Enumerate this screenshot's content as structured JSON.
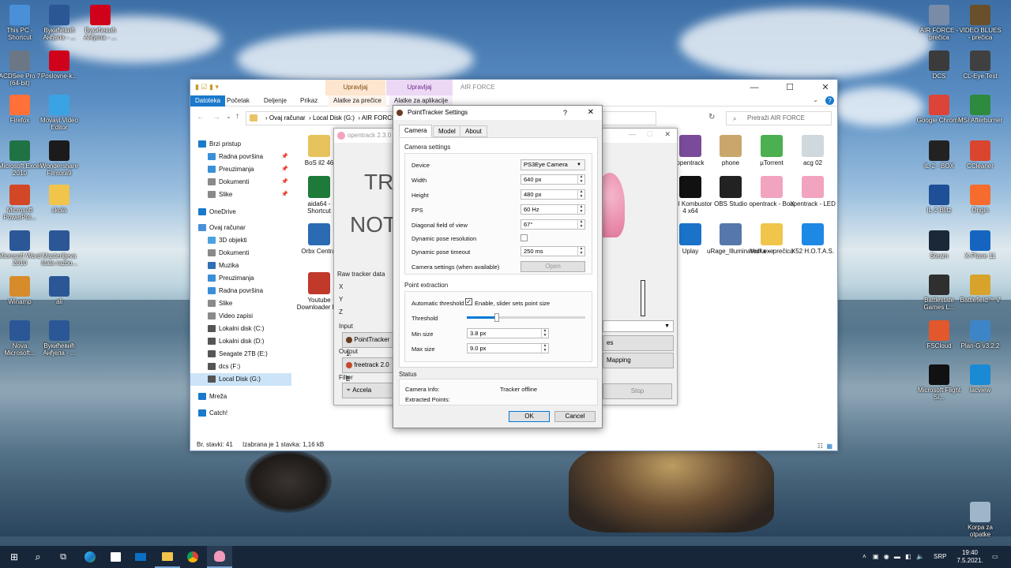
{
  "desktop_left": [
    {
      "label": "This PC - Shortcut",
      "icon": "this-pc-icon"
    },
    {
      "label": "Вукићевић Анђела - ...",
      "icon": "word-doc-icon"
    },
    {
      "label": "Вукићевић Анђела - ...",
      "icon": "pdf-icon"
    },
    {
      "label": "ACDSee Pro 7 (64-bit)",
      "icon": "acdsee-icon"
    },
    {
      "label": "Poslovne-k...",
      "icon": "pdf-icon"
    },
    {
      "label": "Firefox",
      "icon": "firefox-icon"
    },
    {
      "label": "Movavi Video Editor",
      "icon": "movavi-icon"
    },
    {
      "label": "Microsoft Excel 2010",
      "icon": "excel-icon"
    },
    {
      "label": "Wondershare Filmora9",
      "icon": "filmora-icon"
    },
    {
      "label": "Microsoft PowerPoi...",
      "icon": "powerpoint-icon"
    },
    {
      "label": "skola",
      "icon": "folder-icon"
    },
    {
      "label": "Microsoft Word 2010",
      "icon": "word-icon"
    },
    {
      "label": "Masterlijeva štala razbo...",
      "icon": "word-doc-icon"
    },
    {
      "label": "Winamp",
      "icon": "winamp-icon"
    },
    {
      "label": "ali",
      "icon": "word-doc-icon"
    },
    {
      "label": "Nova Microsoft...",
      "icon": "word-doc-icon"
    },
    {
      "label": "Вукићевић Анђела - ...",
      "icon": "word-doc-icon"
    }
  ],
  "desktop_right": [
    {
      "label": "AIR FORCE - prečica",
      "icon": "shortcut-doc-icon"
    },
    {
      "label": "VIDEO BLUES - prečica",
      "icon": "video-folder-icon"
    },
    {
      "label": "DCS",
      "icon": "dcs-icon"
    },
    {
      "label": "CL-Eye Test",
      "icon": "camera-icon"
    },
    {
      "label": "Google Chrome",
      "icon": "chrome-icon"
    },
    {
      "label": "MSI Afterburner",
      "icon": "msi-icon"
    },
    {
      "label": "IL-2 - BOX",
      "icon": "il2-icon"
    },
    {
      "label": "CCleaner",
      "icon": "ccleaner-icon"
    },
    {
      "label": "IL-2 Blitz",
      "icon": "il2-blitz-icon"
    },
    {
      "label": "Origin",
      "icon": "origin-icon"
    },
    {
      "label": "Steam",
      "icon": "steam-icon"
    },
    {
      "label": "X-Plane 11",
      "icon": "xplane-icon"
    },
    {
      "label": "Battlestate Games L...",
      "icon": "battlestate-icon"
    },
    {
      "label": "Battlefield™ V",
      "icon": "battlefield-icon"
    },
    {
      "label": "FSCloud",
      "icon": "fscloud-icon"
    },
    {
      "label": "Plan-G v3.2.2",
      "icon": "planeg-icon"
    },
    {
      "label": "Microsoft Flight Si...",
      "icon": "flightsim-icon"
    },
    {
      "label": "lacview",
      "icon": "lacview-icon"
    },
    {
      "label": "Korpa za otpatke",
      "icon": "recycle-bin-icon"
    }
  ],
  "explorer": {
    "quick_tabs": [
      "Upravljaj",
      "Upravljaj"
    ],
    "path_title": "AIR FORCE",
    "ribbon_tabs": [
      "Datoteka",
      "Početak",
      "Deljenje",
      "Prikaz",
      "Alatke za prečice",
      "Alatke za aplikacije"
    ],
    "address": [
      "Ovaj računar",
      "Local Disk (G:)",
      "AIR FORCE"
    ],
    "search_placeholder": "Pretraži AIR FORCE",
    "nav": [
      "Brzi pristup",
      "Radna površina",
      "Preuzimanja",
      "Dokumenti",
      "Slike",
      "OneDrive",
      "Ovaj računar",
      "3D objekti",
      "Dokumenti",
      "Muzika",
      "Preuzimanja",
      "Radna površina",
      "Slike",
      "Video zapisi",
      "Lokalni disk (C:)",
      "Lokalni disk (D:)",
      "Seagate 2TB (E:)",
      "dcs (F:)",
      "Local Disk (G:)",
      "Mreža",
      "Catch!"
    ],
    "files_left": [
      {
        "label": "BoS il2 46"
      },
      {
        "label": "aida64 - Shortcut"
      },
      {
        "label": "Orbx Central"
      },
      {
        "label": "Youtube Downloader HD"
      }
    ],
    "files_right": [
      {
        "label": "opentrack"
      },
      {
        "label": "phone"
      },
      {
        "label": "µTorrent"
      },
      {
        "label": "acg 02"
      },
      {
        "label": "MSI Kombustor 4 x64"
      },
      {
        "label": "OBS Studio"
      },
      {
        "label": "opentrack - BoX"
      },
      {
        "label": "opentrack - LED"
      },
      {
        "label": "Uplay"
      },
      {
        "label": "uRage_Illuminated².exe"
      },
      {
        "label": "Verka – prečica"
      },
      {
        "label": "X52 H.O.T.A.S."
      }
    ],
    "status_count": "Br. stavki: 41",
    "status_selected": "Izabrana je 1 stavka: 1,16 kB"
  },
  "opentrack": {
    "title": "opentrack 2.3.0",
    "big1": "TR",
    "big2": "NOT",
    "raw_label": "Raw tracker data",
    "axes": [
      "X",
      "Y",
      "Z"
    ],
    "input_label": "Input",
    "input_value": "PointTracker 1.",
    "output_label": "Output",
    "output_value": "freetrack 2.0 E",
    "filter_label": "Filter",
    "filter_value": "Accela",
    "btn_es": "es",
    "btn_mapping": "Mapping",
    "btn_stop": "Stop"
  },
  "dialog": {
    "title": "PointTracker Settings",
    "help": "?",
    "close": "✕",
    "tabs": [
      "Camera",
      "Model",
      "About"
    ],
    "camera_settings": "Camera settings",
    "device_label": "Device",
    "device_value": "PS3Eye Camera",
    "width_label": "Width",
    "width_value": "640 px",
    "height_label": "Height",
    "height_value": "480 px",
    "fps_label": "FPS",
    "fps_value": "60 Hz",
    "fov_label": "Diagonal field of view",
    "fov_value": "67°",
    "dynres_label": "Dynamic pose resolution",
    "dyntimeout_label": "Dynamic pose timeout",
    "dyntimeout_value": "250 ms",
    "camsettings_label": "Camera settings (when available)",
    "open_button": "Open",
    "point_extraction": "Point extraction",
    "auto_threshold_label": "Automatic threshold",
    "auto_threshold_check": "Enable, slider sets point size",
    "threshold_label": "Threshold",
    "threshold_fraction": 0.25,
    "min_size_label": "Min size",
    "min_size_value": "3.8 px",
    "max_size_label": "Max size",
    "max_size_value": "9.0 px",
    "status": "Status",
    "camera_info_label": "Camera Info:",
    "camera_info_value": "Tracker offline",
    "extracted_label": "Extracted Points:",
    "ok": "OK",
    "cancel": "Cancel"
  },
  "taskbar": {
    "lang": "SRP",
    "time": "19:40",
    "date": "7.5.2021."
  }
}
